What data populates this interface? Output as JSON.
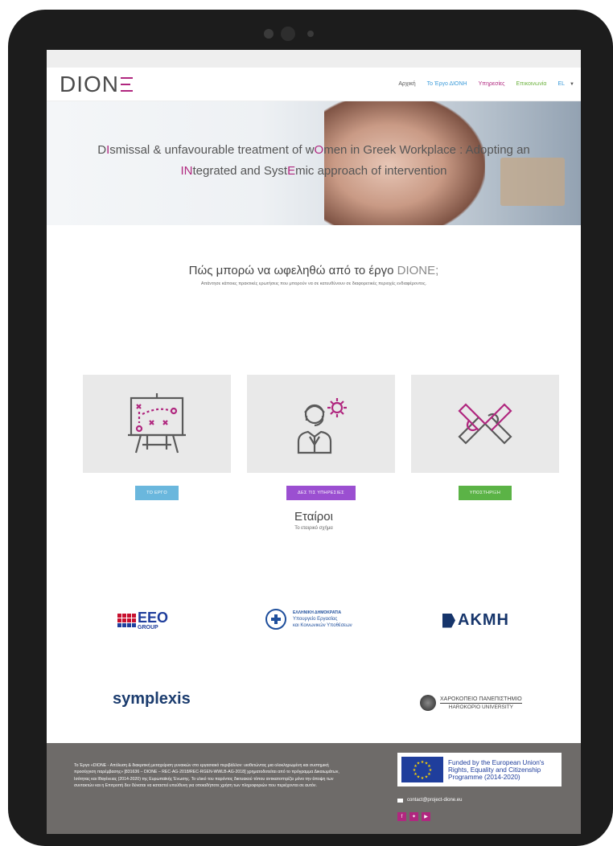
{
  "nav": {
    "logo": "DION",
    "items": [
      {
        "label": "Αρχική",
        "color": "#555555"
      },
      {
        "label": "Το Έργο ΔΙΟΝΗ",
        "color": "#3a9ad9"
      },
      {
        "label": "Υπηρεσίες",
        "color": "#b0277f"
      },
      {
        "label": "Επικοινωνία",
        "color": "#6db33f"
      },
      {
        "label": "EL",
        "color": "#3a9ad9"
      }
    ],
    "dropdown_icon": "chevron-down-icon"
  },
  "hero": {
    "line1": [
      {
        "t": "D",
        "a": false
      },
      {
        "t": "I",
        "a": true
      },
      {
        "t": "smissal & unfavourable treatment of w",
        "a": false
      },
      {
        "t": "O",
        "a": true
      },
      {
        "t": "men in Greek Workplace : Adopting an",
        "a": false
      }
    ],
    "line2": [
      {
        "t": "IN",
        "a": true
      },
      {
        "t": "tegrated and Syst",
        "a": false
      },
      {
        "t": "E",
        "a": true
      },
      {
        "t": "mic approach of intervention",
        "a": false
      }
    ]
  },
  "benefit": {
    "title_main": "Πώς μπορώ να ωφεληθώ από το έργο ",
    "title_accent": "DIONE;",
    "subtitle": "Απάντησε κάποιες πρακτικές ερωτήσεις που μπορούν να σε κατευθύνουν σε διαφορετικές περιοχές ενδιαφέροντος."
  },
  "cards": [
    {
      "button": "ΤΟ ΕΡΓΟ",
      "color": "#6ab7dd",
      "icon": "strategy-board-icon"
    },
    {
      "button": "ΔΕΣ ΤΙΣ ΥΠΗΡΕΣΙΕΣ",
      "color": "#9b4fd1",
      "icon": "support-agent-icon"
    },
    {
      "button": "ΥΠΟΣΤΗΡΙΞΗ",
      "color": "#5bb346",
      "icon": "holding-hands-icon"
    }
  ],
  "partners": {
    "title": "Εταίροι",
    "subtitle": "Το εταιρικό σχήμα",
    "eeo": {
      "name": "EEO",
      "sub": "GROUP"
    },
    "ministry": {
      "l1": "ΕΛΛΗΝΙΚΗ ΔΗΜΟΚΡΑΤΙΑ",
      "l2": "Υπουργείο Εργασίας",
      "l3": "και Κοινωνικών Υποθέσεων"
    },
    "akmi": "AKMH",
    "symplexis": "symplexis",
    "harokopio": {
      "l1": "ΧΑΡΟΚΟΠΕΙΟ ΠΑΝΕΠΙΣΤΗΜΙΟ",
      "l2": "HAROKOPIO UNIVERSITY"
    }
  },
  "footer": {
    "text": "Το Έργο «DIONE - Απόλυση & διακριτική μεταχείριση γυναικών στο εργασιακό περιβάλλον: υιοθετώντας μια ολοκληρωμένη και συστημική προσέγγιση παρέμβασης» [831636 – DIONE – REC-AG-2018/REC-RGEN-WWLB-AG-2018] χρηματοδοτείται από το πρόγραμμα Δικαιωμάτων, Ισότητας και Ιθαγένειας (2014-2020) της Ευρωπαϊκής Ένωσης. Το υλικό του παρόντος δικτυακού τόπου αντικατοπτρίζει μόνο την άποψη των συντακτών και η Επιτροπή δεν δύναται να καταστεί υπεύθυνη για οποιαδήποτε χρήση των πληροφοριών που περιέχονται σε αυτόν.",
    "eu_l1": "Funded by the European Union's",
    "eu_l2": "Rights, Equality and Citizenship",
    "eu_l3": "Programme (2014-2020)",
    "email": "contact@project-dione.eu",
    "socials": [
      {
        "icon": "facebook-icon",
        "glyph": "f"
      },
      {
        "icon": "twitter-icon",
        "glyph": "✦"
      },
      {
        "icon": "youtube-icon",
        "glyph": "▶"
      }
    ]
  }
}
